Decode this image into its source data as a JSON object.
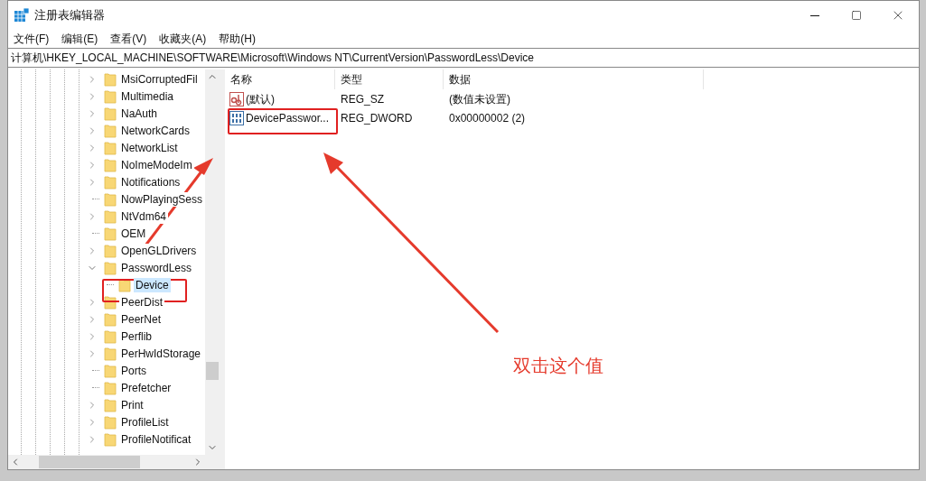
{
  "window": {
    "title": "注册表编辑器"
  },
  "menu": [
    {
      "label": "文件(F)"
    },
    {
      "label": "编辑(E)"
    },
    {
      "label": "查看(V)"
    },
    {
      "label": "收藏夹(A)"
    },
    {
      "label": "帮助(H)"
    }
  ],
  "address": "计算机\\HKEY_LOCAL_MACHINE\\SOFTWARE\\Microsoft\\Windows NT\\CurrentVersion\\PasswordLess\\Device",
  "tree": [
    {
      "label": "MsiCorruptedFil",
      "kind": "branch",
      "expanded": false,
      "selected": false
    },
    {
      "label": "Multimedia",
      "kind": "branch",
      "expanded": false,
      "selected": false
    },
    {
      "label": "NaAuth",
      "kind": "branch",
      "expanded": false,
      "selected": false
    },
    {
      "label": "NetworkCards",
      "kind": "branch",
      "expanded": false,
      "selected": false
    },
    {
      "label": "NetworkList",
      "kind": "branch",
      "expanded": false,
      "selected": false
    },
    {
      "label": "NoImeModeIm",
      "kind": "branch",
      "expanded": false,
      "selected": false
    },
    {
      "label": "Notifications",
      "kind": "branch",
      "expanded": false,
      "selected": false
    },
    {
      "label": "NowPlayingSess",
      "kind": "leaf",
      "selected": false
    },
    {
      "label": "NtVdm64",
      "kind": "branch",
      "expanded": false,
      "selected": false
    },
    {
      "label": "OEM",
      "kind": "leaf",
      "selected": false
    },
    {
      "label": "OpenGLDrivers",
      "kind": "branch",
      "expanded": false,
      "selected": false
    },
    {
      "label": "PasswordLess",
      "kind": "branch",
      "expanded": true,
      "selected": false,
      "children": [
        {
          "label": "Device",
          "kind": "leaf",
          "selected": true
        }
      ]
    },
    {
      "label": "PeerDist",
      "kind": "branch",
      "expanded": false,
      "selected": false
    },
    {
      "label": "PeerNet",
      "kind": "branch",
      "expanded": false,
      "selected": false
    },
    {
      "label": "Perflib",
      "kind": "branch",
      "expanded": false,
      "selected": false
    },
    {
      "label": "PerHwIdStorage",
      "kind": "branch",
      "expanded": false,
      "selected": false
    },
    {
      "label": "Ports",
      "kind": "leaf",
      "selected": false
    },
    {
      "label": "Prefetcher",
      "kind": "leaf",
      "selected": false
    },
    {
      "label": "Print",
      "kind": "branch",
      "expanded": false,
      "selected": false
    },
    {
      "label": "ProfileList",
      "kind": "branch",
      "expanded": false,
      "selected": false
    },
    {
      "label": "ProfileNotificat",
      "kind": "branch",
      "expanded": false,
      "selected": false
    }
  ],
  "table": {
    "columns": [
      "名称",
      "类型",
      "数据"
    ],
    "rows": [
      {
        "kind": "string",
        "name": "(默认)",
        "type": "REG_SZ",
        "data": "(数值未设置)"
      },
      {
        "kind": "binary",
        "name": "DevicePasswor...",
        "type": "REG_DWORD",
        "data": "0x00000002 (2)"
      }
    ]
  },
  "annotation": {
    "text": "双击这个值"
  }
}
